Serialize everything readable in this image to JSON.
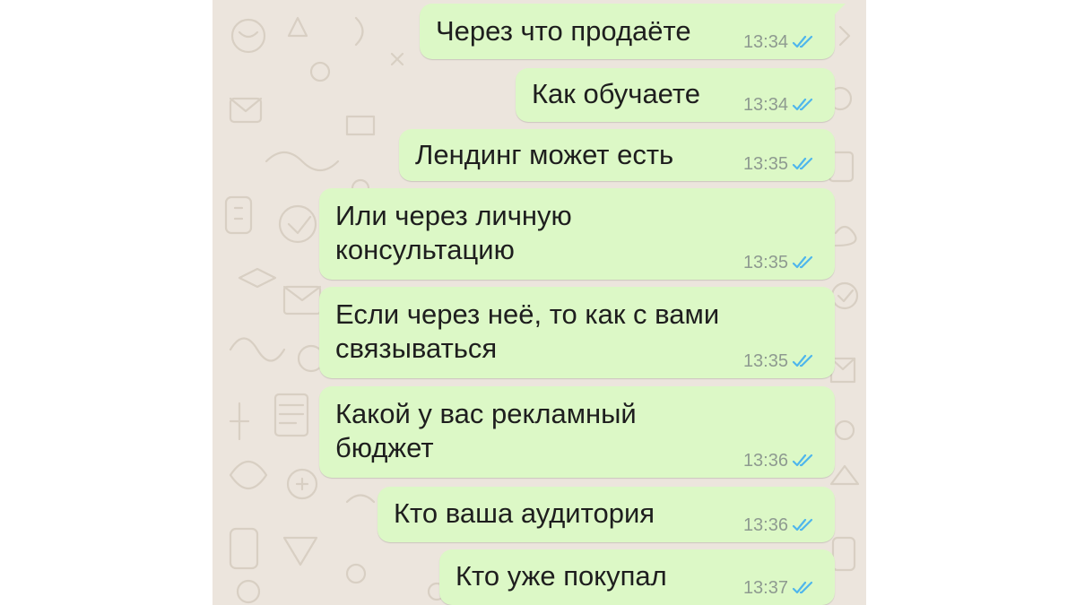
{
  "colors": {
    "chat_background": "#ECE5DD",
    "outgoing_bubble": "#DCF8C6",
    "read_ticks": "#4FB6EC",
    "timestamp": "#8E9A90",
    "message_text": "#1E1E1E"
  },
  "messages": [
    {
      "text": "Через что продаёте",
      "time": "13:34",
      "status": "read",
      "status_icon": "double-check-icon"
    },
    {
      "text": "Как обучаете",
      "time": "13:34",
      "status": "read",
      "status_icon": "double-check-icon"
    },
    {
      "text": "Лендинг может есть",
      "time": "13:35",
      "status": "read",
      "status_icon": "double-check-icon"
    },
    {
      "text": "Или через личную\nконсультацию",
      "time": "13:35",
      "status": "read",
      "status_icon": "double-check-icon"
    },
    {
      "text": "Если через неё, то как с вами\nсвязываться",
      "time": "13:35",
      "status": "read",
      "status_icon": "double-check-icon"
    },
    {
      "text": "Какой у вас рекламный\nбюджет",
      "time": "13:36",
      "status": "read",
      "status_icon": "double-check-icon"
    },
    {
      "text": "Кто ваша аудитория",
      "time": "13:36",
      "status": "read",
      "status_icon": "double-check-icon"
    },
    {
      "text": "Кто уже покупал",
      "time": "13:37",
      "status": "read",
      "status_icon": "double-check-icon"
    }
  ]
}
